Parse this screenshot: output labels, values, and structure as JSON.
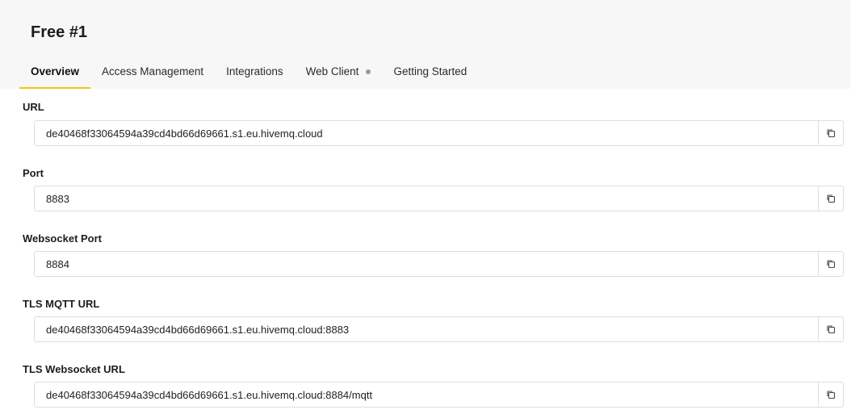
{
  "header": {
    "title": "Free #1"
  },
  "tabs": [
    {
      "label": "Overview",
      "active": true
    },
    {
      "label": "Access Management",
      "active": false
    },
    {
      "label": "Integrations",
      "active": false
    },
    {
      "label": "Web Client",
      "active": false,
      "status_dot": true
    },
    {
      "label": "Getting Started",
      "active": false
    }
  ],
  "fields": [
    {
      "label": "URL",
      "value": "de40468f33064594a39cd4bd66d69661.s1.eu.hivemq.cloud"
    },
    {
      "label": "Port",
      "value": "8883"
    },
    {
      "label": "Websocket Port",
      "value": "8884"
    },
    {
      "label": "TLS MQTT URL",
      "value": "de40468f33064594a39cd4bd66d69661.s1.eu.hivemq.cloud:8883"
    },
    {
      "label": "TLS Websocket URL",
      "value": "de40468f33064594a39cd4bd66d69661.s1.eu.hivemq.cloud:8884/mqtt"
    }
  ],
  "icons": {
    "copy": "copy-icon"
  },
  "colors": {
    "accent": "#f3c413",
    "header_bg": "#f7f7f7",
    "border": "#dedede"
  }
}
